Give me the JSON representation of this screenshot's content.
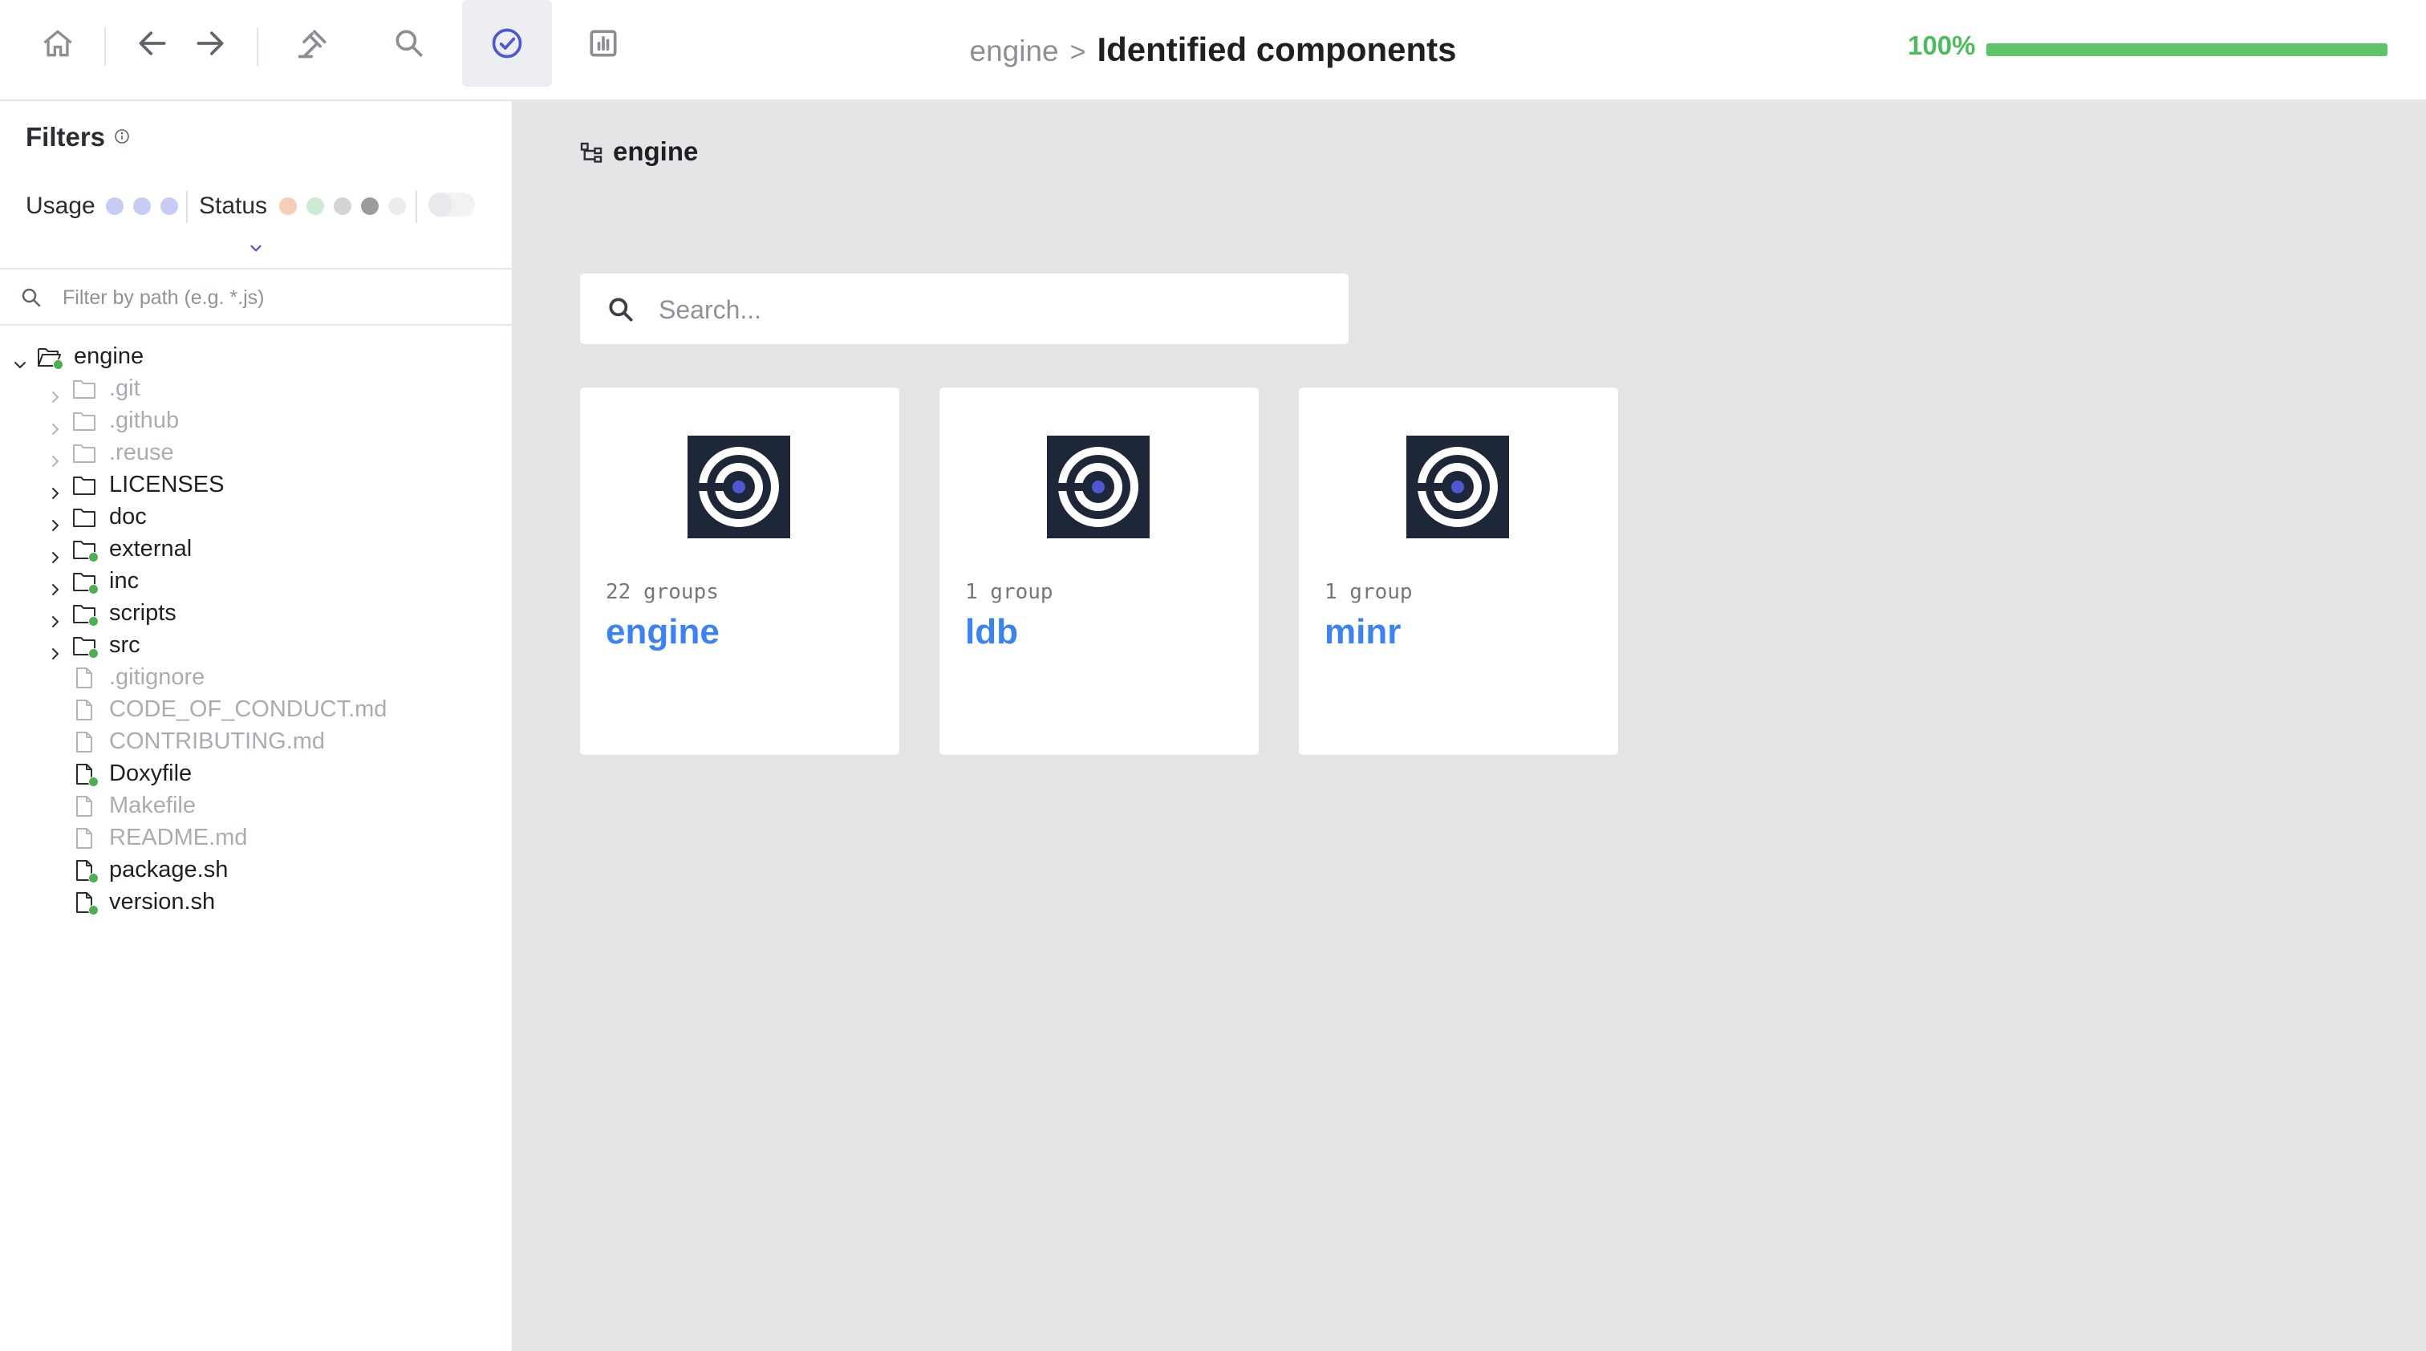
{
  "toolbar": {
    "buttons": [
      {
        "name": "home",
        "icon": "home-icon"
      },
      {
        "name": "back",
        "icon": "arrow-left-icon"
      },
      {
        "name": "forward",
        "icon": "arrow-right-icon"
      },
      {
        "name": "audit",
        "icon": "gavel-icon"
      },
      {
        "name": "search",
        "icon": "search-icon"
      },
      {
        "name": "identified",
        "icon": "check-circle-icon",
        "active": true
      },
      {
        "name": "report",
        "icon": "chart-icon"
      }
    ],
    "active_color": "#4f56d3"
  },
  "breadcrumb": {
    "parent": "engine",
    "separator": ">",
    "current": "Identified components"
  },
  "progress": {
    "label": "100%",
    "value": 1.0,
    "color": "#5cc466"
  },
  "sidebar": {
    "title": "Filters",
    "usage_label": "Usage",
    "status_label": "Status",
    "usage_colors": [
      "#c7cbf5",
      "#c7cbf5",
      "#c7cbf5"
    ],
    "status_colors": [
      "#f6cdb5",
      "#cdebd1",
      "#d3d4d8",
      "#9b9ca0",
      "#ececee"
    ],
    "path_filter_placeholder": "Filter by path (e.g. *.js)",
    "tree": [
      {
        "label": "engine",
        "type": "folder",
        "level": 0,
        "expanded": true,
        "dot": true,
        "muted": false
      },
      {
        "label": ".git",
        "type": "folder",
        "level": 1,
        "dot": false,
        "muted": true
      },
      {
        "label": ".github",
        "type": "folder",
        "level": 1,
        "dot": false,
        "muted": true
      },
      {
        "label": ".reuse",
        "type": "folder",
        "level": 1,
        "dot": false,
        "muted": true
      },
      {
        "label": "LICENSES",
        "type": "folder",
        "level": 1,
        "dot": false,
        "muted": false
      },
      {
        "label": "doc",
        "type": "folder",
        "level": 1,
        "dot": false,
        "muted": false
      },
      {
        "label": "external",
        "type": "folder",
        "level": 1,
        "dot": true,
        "muted": false
      },
      {
        "label": "inc",
        "type": "folder",
        "level": 1,
        "dot": true,
        "muted": false
      },
      {
        "label": "scripts",
        "type": "folder",
        "level": 1,
        "dot": true,
        "muted": false
      },
      {
        "label": "src",
        "type": "folder",
        "level": 1,
        "dot": true,
        "muted": false
      },
      {
        "label": ".gitignore",
        "type": "file",
        "level": 1,
        "dot": false,
        "muted": true
      },
      {
        "label": "CODE_OF_CONDUCT.md",
        "type": "file",
        "level": 1,
        "dot": false,
        "muted": true
      },
      {
        "label": "CONTRIBUTING.md",
        "type": "file",
        "level": 1,
        "dot": false,
        "muted": true
      },
      {
        "label": "Doxyfile",
        "type": "file",
        "level": 1,
        "dot": true,
        "muted": false
      },
      {
        "label": "Makefile",
        "type": "file",
        "level": 1,
        "dot": false,
        "muted": true
      },
      {
        "label": "README.md",
        "type": "file",
        "level": 1,
        "dot": false,
        "muted": true
      },
      {
        "label": "package.sh",
        "type": "file",
        "level": 1,
        "dot": true,
        "muted": false
      },
      {
        "label": "version.sh",
        "type": "file",
        "level": 1,
        "dot": true,
        "muted": false
      }
    ]
  },
  "main": {
    "title": "engine",
    "title_icon": "tree-structure-icon",
    "search_placeholder": "Search...",
    "cards": [
      {
        "count": "22 groups",
        "name": "engine",
        "logo": "component-target-icon"
      },
      {
        "count": "1 group",
        "name": "ldb",
        "logo": "component-target-icon"
      },
      {
        "count": "1 group",
        "name": "minr",
        "logo": "component-target-icon"
      }
    ],
    "accent_color": "#3b82f6"
  }
}
